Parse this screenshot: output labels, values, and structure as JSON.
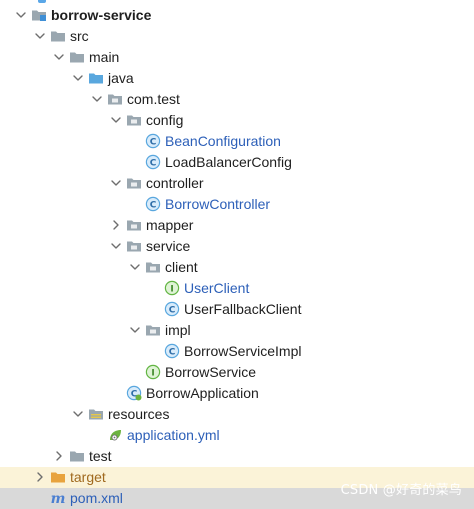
{
  "project_tree": {
    "rows": [
      {
        "label": "borrow-service",
        "icon": "module-folder-icon",
        "expanded": true
      },
      {
        "label": "src",
        "icon": "folder-icon",
        "expanded": true
      },
      {
        "label": "main",
        "icon": "folder-icon",
        "expanded": true
      },
      {
        "label": "java",
        "icon": "source-root-folder-icon",
        "expanded": true
      },
      {
        "label": "com.test",
        "icon": "package-icon",
        "expanded": true
      },
      {
        "label": "config",
        "icon": "package-icon",
        "expanded": true
      },
      {
        "label": "BeanConfiguration",
        "icon": "class-icon"
      },
      {
        "label": "LoadBalancerConfig",
        "icon": "class-icon"
      },
      {
        "label": "controller",
        "icon": "package-icon",
        "expanded": true
      },
      {
        "label": "BorrowController",
        "icon": "class-icon"
      },
      {
        "label": "mapper",
        "icon": "package-icon",
        "expanded": false
      },
      {
        "label": "service",
        "icon": "package-icon",
        "expanded": true
      },
      {
        "label": "client",
        "icon": "package-icon",
        "expanded": true
      },
      {
        "label": "UserClient",
        "icon": "interface-icon"
      },
      {
        "label": "UserFallbackClient",
        "icon": "class-icon"
      },
      {
        "label": "impl",
        "icon": "package-icon",
        "expanded": true
      },
      {
        "label": "BorrowServiceImpl",
        "icon": "class-icon"
      },
      {
        "label": "BorrowService",
        "icon": "interface-icon"
      },
      {
        "label": "BorrowApplication",
        "icon": "spring-boot-class-icon"
      },
      {
        "label": "resources",
        "icon": "resources-folder-icon",
        "expanded": true
      },
      {
        "label": "application.yml",
        "icon": "spring-yml-file-icon"
      },
      {
        "label": "test",
        "icon": "folder-icon",
        "expanded": false
      },
      {
        "label": "target",
        "icon": "excluded-folder-icon",
        "expanded": false
      },
      {
        "label": "pom.xml",
        "icon": "maven-file-icon"
      }
    ]
  },
  "watermark": "CSDN @好奇的菜鸟",
  "colors": {
    "modified_blue": "#2c5fb8",
    "class_icon": "#59a7de",
    "interface_icon": "#62b543",
    "folder": "#9aa7b0",
    "excluded_folder": "#e8a33d",
    "selected_row": "#d9d9d9"
  }
}
